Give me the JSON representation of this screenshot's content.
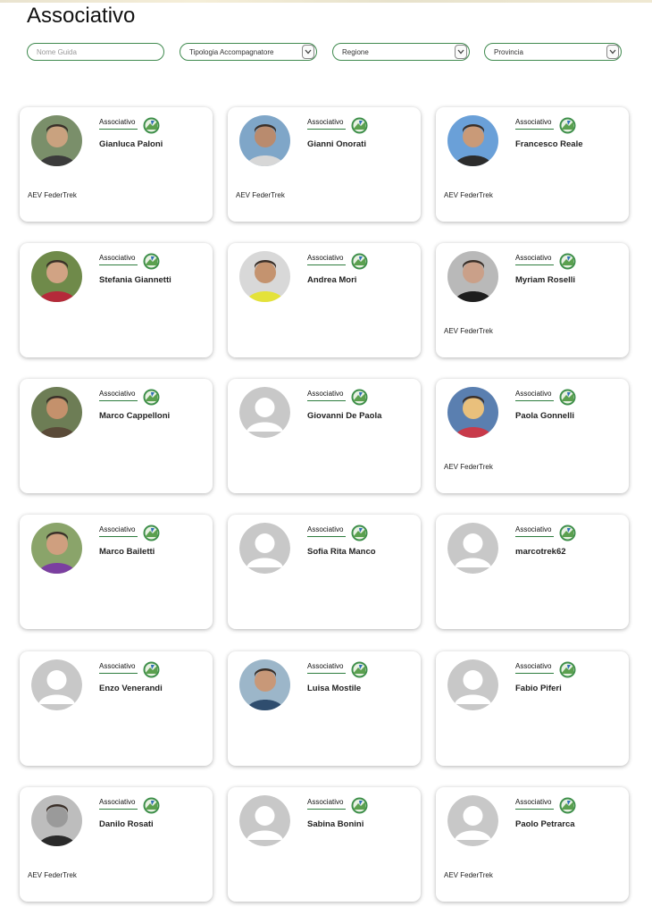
{
  "page": {
    "title": "Associativo"
  },
  "filters": {
    "search_placeholder": "Nome Guida",
    "tipologia": "Tipologia Accompagnatore",
    "regione": "Regione",
    "provincia": "Provincia"
  },
  "cards": [
    {
      "role": "Associativo",
      "name": "Gianluca Paloni",
      "org": "AEV FederTrek",
      "avatar": "photo"
    },
    {
      "role": "Associativo",
      "name": "Gianni Onorati",
      "org": "AEV FederTrek",
      "avatar": "photo"
    },
    {
      "role": "Associativo",
      "name": "Francesco Reale",
      "org": "AEV FederTrek",
      "avatar": "photo"
    },
    {
      "role": "Associativo",
      "name": "Stefania Giannetti",
      "org": "",
      "avatar": "photo"
    },
    {
      "role": "Associativo",
      "name": "Andrea Mori",
      "org": "",
      "avatar": "photo"
    },
    {
      "role": "Associativo",
      "name": "Myriam Roselli",
      "org": "AEV FederTrek",
      "avatar": "photo"
    },
    {
      "role": "Associativo",
      "name": "Marco Cappelloni",
      "org": "",
      "avatar": "photo"
    },
    {
      "role": "Associativo",
      "name": "Giovanni De Paola",
      "org": "",
      "avatar": "placeholder"
    },
    {
      "role": "Associativo",
      "name": "Paola Gonnelli",
      "org": "AEV FederTrek",
      "avatar": "photo"
    },
    {
      "role": "Associativo",
      "name": "Marco Bailetti",
      "org": "",
      "avatar": "photo"
    },
    {
      "role": "Associativo",
      "name": "Sofia Rita Manco",
      "org": "",
      "avatar": "placeholder"
    },
    {
      "role": "Associativo",
      "name": "marcotrek62",
      "org": "",
      "avatar": "placeholder"
    },
    {
      "role": "Associativo",
      "name": "Enzo Venerandi",
      "org": "",
      "avatar": "placeholder"
    },
    {
      "role": "Associativo",
      "name": "Luisa Mostile",
      "org": "",
      "avatar": "photo"
    },
    {
      "role": "Associativo",
      "name": "Fabio Piferi",
      "org": "",
      "avatar": "placeholder"
    },
    {
      "role": "Associativo",
      "name": "Danilo Rosati",
      "org": "AEV FederTrek",
      "avatar": "photo"
    },
    {
      "role": "Associativo",
      "name": "Sabina Bonini",
      "org": "",
      "avatar": "placeholder"
    },
    {
      "role": "Associativo",
      "name": "Paolo Petrarca",
      "org": "AEV FederTrek",
      "avatar": "placeholder"
    }
  ],
  "colors": {
    "accent": "#2e7d3e",
    "placeholder_bg": "#c8c8c8"
  },
  "icons": {
    "badge": "trek-logo-icon",
    "dropdown": "chevron-down-icon"
  }
}
